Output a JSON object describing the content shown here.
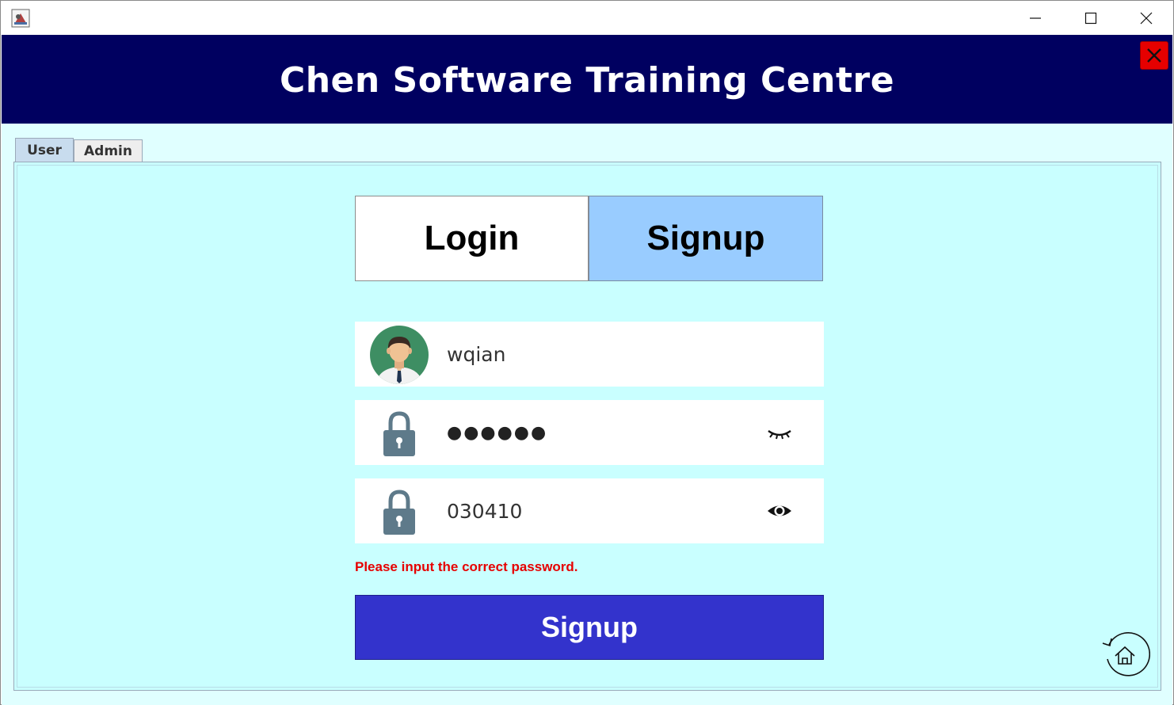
{
  "window": {
    "title": "",
    "controls": {
      "minimize_icon": "minimize-icon",
      "maximize_icon": "maximize-icon",
      "close_icon": "close-icon"
    }
  },
  "header": {
    "title": "Chen Software Training Centre",
    "background": "#000060",
    "exit_button_color": "#e60000"
  },
  "tabs": [
    {
      "label": "User",
      "selected": true
    },
    {
      "label": "Admin",
      "selected": false
    }
  ],
  "mode_switch": {
    "login_label": "Login",
    "signup_label": "Signup",
    "active": "Signup",
    "active_color": "#99ccff"
  },
  "form": {
    "username": {
      "value": "wqian",
      "icon": "user-avatar-icon"
    },
    "password": {
      "value": "●●●●●●",
      "masked": true,
      "icon": "lock-icon",
      "toggle_icon": "eye-closed-icon"
    },
    "confirm_password": {
      "value": "030410",
      "masked": false,
      "icon": "lock-icon",
      "toggle_icon": "eye-open-icon"
    },
    "error_message": "Please input the correct password.",
    "submit_label": "Signup",
    "submit_color": "#3333cc",
    "error_color": "#e60000"
  },
  "home_button": {
    "icon": "home-refresh-icon"
  },
  "colors": {
    "panel_background": "#c9ffff",
    "content_background": "#e0ffff"
  }
}
